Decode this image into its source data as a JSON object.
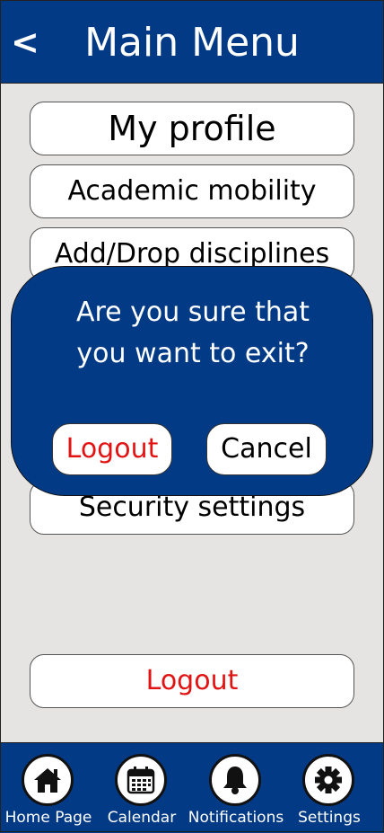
{
  "header": {
    "back_label": "<",
    "title": "Main Menu"
  },
  "menu": {
    "items": [
      {
        "label": "My profile"
      },
      {
        "label": "Academic mobility"
      },
      {
        "label": "Add/Drop disciplines"
      },
      {
        "label": "Security settings"
      }
    ],
    "logout_label": "Logout"
  },
  "dialog": {
    "line1": "Are you sure that",
    "line2": "you want to exit?",
    "logout_label": "Logout",
    "cancel_label": "Cancel"
  },
  "tabbar": {
    "tabs": [
      {
        "label": "Home Page",
        "icon": "home-icon"
      },
      {
        "label": "Calendar",
        "icon": "calendar-icon"
      },
      {
        "label": "Notifications",
        "icon": "bell-icon"
      },
      {
        "label": "Settings",
        "icon": "gear-icon"
      }
    ]
  },
  "colors": {
    "primary": "#023a86",
    "background": "#e6e4e3",
    "danger": "#e21313"
  }
}
